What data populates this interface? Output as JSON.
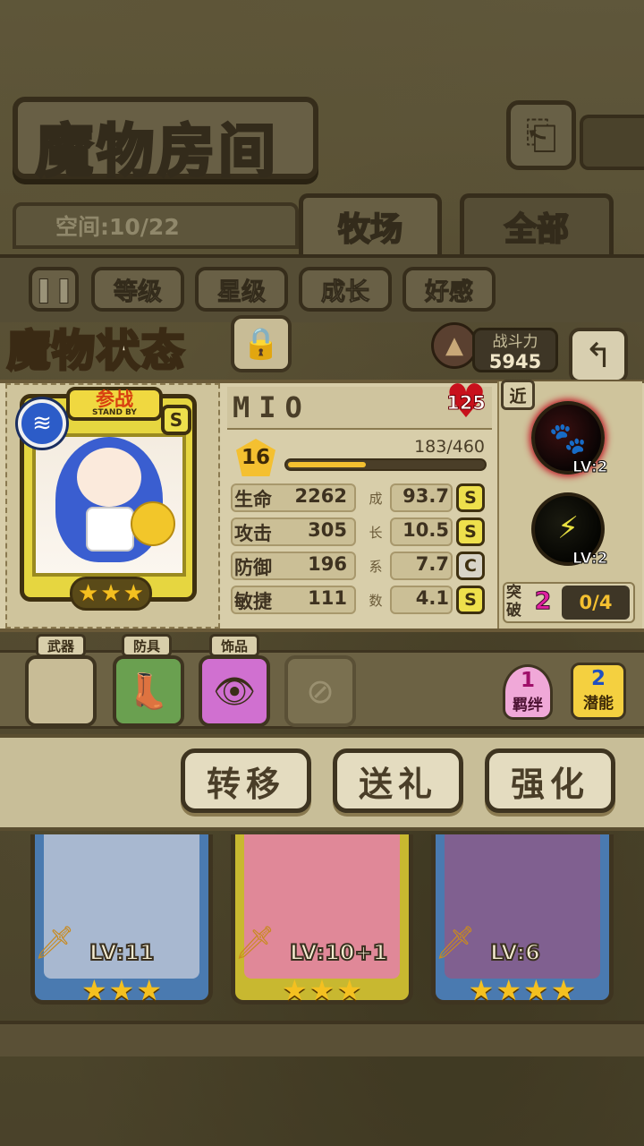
{
  "header": {
    "title": "魔物房间",
    "back_icon": "back-icon"
  },
  "tabs": {
    "space_label": "空间:10/22",
    "items": [
      {
        "label": "牧场",
        "active": true
      },
      {
        "label": "全部",
        "active": false
      }
    ]
  },
  "sort": {
    "toggle_icon": "pause-icon",
    "buttons": [
      "等级",
      "星级",
      "成长",
      "好感"
    ]
  },
  "status": {
    "title": "魔物状态",
    "power_label": "战斗力",
    "power_value": "5945"
  },
  "monster": {
    "name": "MIO",
    "affection": "125",
    "standby_cn": "参战",
    "standby_en": "STAND BY",
    "rank": "S",
    "element_icon": "water-icon",
    "level": "16",
    "exp_text": "183/460",
    "exp_fraction": 0.398,
    "stars": 3,
    "stats": [
      {
        "label": "生命",
        "value": "2262",
        "growth": "93.7",
        "grade": "S",
        "growth_char": "成"
      },
      {
        "label": "攻击",
        "value": "305",
        "growth": "10.5",
        "grade": "S",
        "growth_char": "长"
      },
      {
        "label": "防御",
        "value": "196",
        "growth": "7.7",
        "grade": "C",
        "growth_char": "系"
      },
      {
        "label": "敏捷",
        "value": "111",
        "growth": "4.1",
        "grade": "S",
        "growth_char": "数"
      }
    ]
  },
  "skills": {
    "tag": "近",
    "items": [
      {
        "icon": "paw-icon",
        "level": "LV:2"
      },
      {
        "icon": "lightning-icon",
        "level": "LV:2"
      }
    ],
    "breakthrough_label": "突破",
    "breakthrough_value": "2",
    "breakthrough_count": "0/4"
  },
  "equipment": {
    "slots": [
      {
        "label": "武器",
        "icon": "",
        "color": "#c8bc96"
      },
      {
        "label": "防具",
        "icon": "boot-icon",
        "color": "#6aa050"
      },
      {
        "label": "饰品",
        "icon": "eye-amulet-icon",
        "color": "#d070d0"
      }
    ],
    "locked_icon": "prohibited-icon",
    "bond": {
      "count": "1",
      "label": "羁绊"
    },
    "potential": {
      "count": "2",
      "label": "潜能"
    }
  },
  "actions": [
    "转移",
    "送礼",
    "强化"
  ],
  "monster_cards": [
    {
      "level": "LV:11",
      "stars": 3,
      "frame_color": "#4a7ab0",
      "bg_color": "#a8b8d0"
    },
    {
      "level": "LV:10+1",
      "stars": 3,
      "frame_color": "#c8b830",
      "bg_color": "#e08898"
    },
    {
      "level": "LV:6",
      "stars": 4,
      "frame_color": "#4a7ab0",
      "bg_color": "#806090"
    }
  ]
}
